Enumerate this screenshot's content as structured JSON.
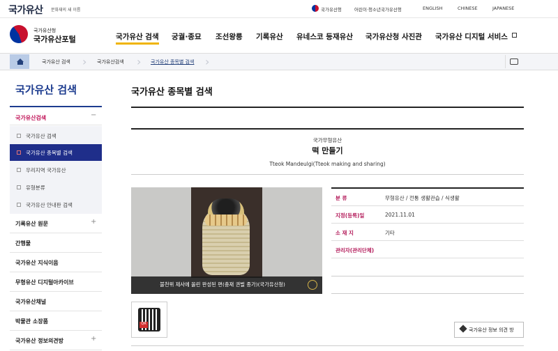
{
  "topbar": {
    "logo": "국가유산",
    "logo_sub": "문화재의 새 이름",
    "links": [
      "국가유산청",
      "어린이·청소년국가유산청",
      "ENGLISH",
      "CHINESE",
      "JAPANESE"
    ]
  },
  "header": {
    "portal_sub": "국가유산청",
    "portal_title": "국가유산포털",
    "menu": [
      "국가유산 검색",
      "궁궐·종묘",
      "조선왕릉",
      "기록유산",
      "유네스코 등재유산",
      "국가유산청 사진관",
      "국가유산 디지털 서비스"
    ]
  },
  "breadcrumb": [
    "국가유산 검색",
    "국가유산검색",
    "국가유산 종목별 검색"
  ],
  "lnb": {
    "title": "국가유산 검색",
    "group": "국가유산검색",
    "sub_items": [
      "국가유산 검색",
      "국가유산 종목별 검색",
      "우리지역 국가유산",
      "유형분류",
      "국가유산 안내판 검색"
    ],
    "active_sub": 1,
    "items": [
      "기록유산 원문",
      "간행물",
      "국가유산 지식이음",
      "무형유산 디지털아카이브",
      "국가유산채널",
      "박물관 소장품",
      "국가유산 정보의견방"
    ]
  },
  "main": {
    "title": "국가유산 종목별 검색",
    "category": "국가무형유산",
    "name": "떡 만들기",
    "name_en": "Tteok Mandeulgi(Tteok making and sharing)",
    "photo_caption": "불천위 제사에 올린 완성된 편(충재 권벌 종가)(국가유산청)",
    "info": [
      {
        "key": "분 류",
        "value": "무형유산 / 전통 생활관습 / 식생활"
      },
      {
        "key": "지정(등록)일",
        "value": "2021.11.01"
      },
      {
        "key": "소 재 지",
        "value": "기타"
      },
      {
        "key": "관리자(관리단체)",
        "value": ""
      }
    ],
    "qr_label": "QR",
    "opinion_button": "국가유산 정보 의견 방"
  },
  "colors": {
    "accent_blue": "#1d3c8f",
    "accent_pink": "#b31b5a",
    "highlight_yellow": "#f0b400"
  }
}
